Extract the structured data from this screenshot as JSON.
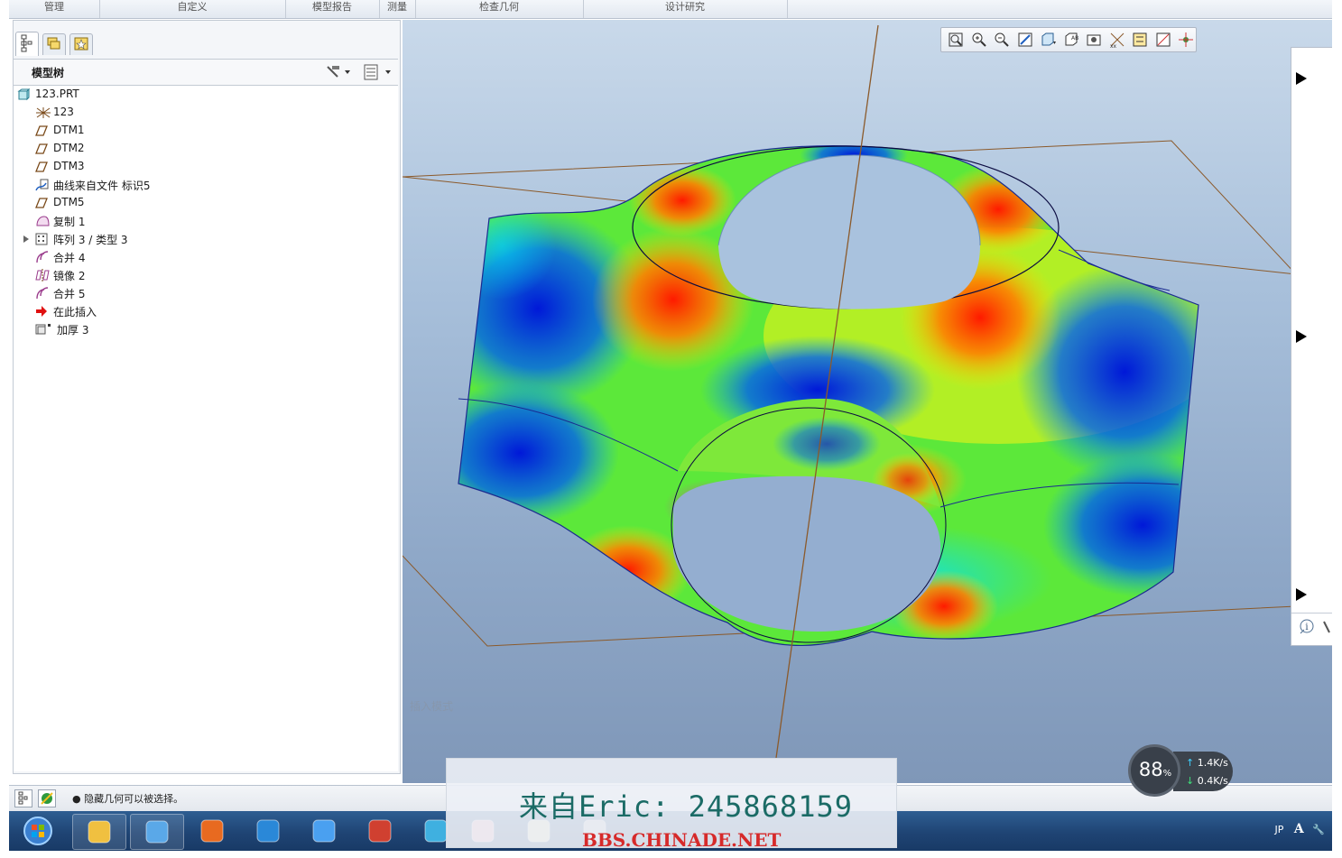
{
  "ribbon": {
    "tabs": [
      "管理",
      "自定义",
      "模型报告",
      "测量",
      "检查几何",
      "设计研究"
    ]
  },
  "left_panel": {
    "tabs": [
      {
        "name": "model-tree-tab",
        "icon": "tree-icon"
      },
      {
        "name": "folder-browser-tab",
        "icon": "folders-icon"
      },
      {
        "name": "favorites-tab",
        "icon": "star-icon"
      }
    ],
    "tree_title": "模型树",
    "tree_items": [
      {
        "label": "123.PRT",
        "icon": "part-icon",
        "indent": 0
      },
      {
        "label": "123",
        "icon": "coordinate-system-icon",
        "indent": 1
      },
      {
        "label": "DTM1",
        "icon": "datum-plane-icon",
        "indent": 1
      },
      {
        "label": "DTM2",
        "icon": "datum-plane-icon",
        "indent": 1
      },
      {
        "label": "DTM3",
        "icon": "datum-plane-icon",
        "indent": 1
      },
      {
        "label": "曲线来自文件 标识5",
        "icon": "curve-from-file-icon",
        "indent": 1
      },
      {
        "label": "DTM5",
        "icon": "datum-plane-icon",
        "indent": 1
      },
      {
        "label": "复制 1",
        "icon": "copy-surface-icon",
        "indent": 1
      },
      {
        "label": "阵列 3 / 类型 3",
        "icon": "pattern-icon",
        "indent": 1,
        "expandable": true
      },
      {
        "label": "合并 4",
        "icon": "merge-icon",
        "indent": 1
      },
      {
        "label": "镜像 2",
        "icon": "mirror-icon",
        "indent": 1
      },
      {
        "label": "合并 5",
        "icon": "merge-icon",
        "indent": 1
      },
      {
        "label": "在此插入",
        "icon": "insert-here-arrow-icon",
        "indent": 1
      },
      {
        "label": "加厚 3",
        "icon": "thicken-icon",
        "indent": 1
      }
    ]
  },
  "viewport": {
    "hint": "插入模式",
    "toolbar_icons": [
      "refit-icon",
      "zoom-in-icon",
      "zoom-out-icon",
      "repaint-icon",
      "display-style-icon",
      "saved-views-icon",
      "view-manager-icon",
      "perspective-icon",
      "annotation-display-icon",
      "datum-display-icon",
      "spin-center-icon"
    ]
  },
  "status": {
    "message": "● 隐藏几何可以被选择。"
  },
  "taskbar": {
    "icons": [
      "windows-start-icon",
      "explorer-icon",
      "browser-icon",
      "media-player-icon",
      "ie-icon",
      "chat-icon",
      "archive-icon",
      "bird-app-icon",
      "app-icon",
      "document-icon",
      "globe-icon"
    ],
    "tray_lang": "JP",
    "tray_ime": "A"
  },
  "overlay": {
    "watermark_text": "来自Eric: 245868159",
    "watermark_url": "BBS.CHINADE.NET",
    "speed_percent": "88",
    "speed_unit": "%",
    "upload_speed": "1.4K/s",
    "download_speed": "0.4K/s"
  }
}
